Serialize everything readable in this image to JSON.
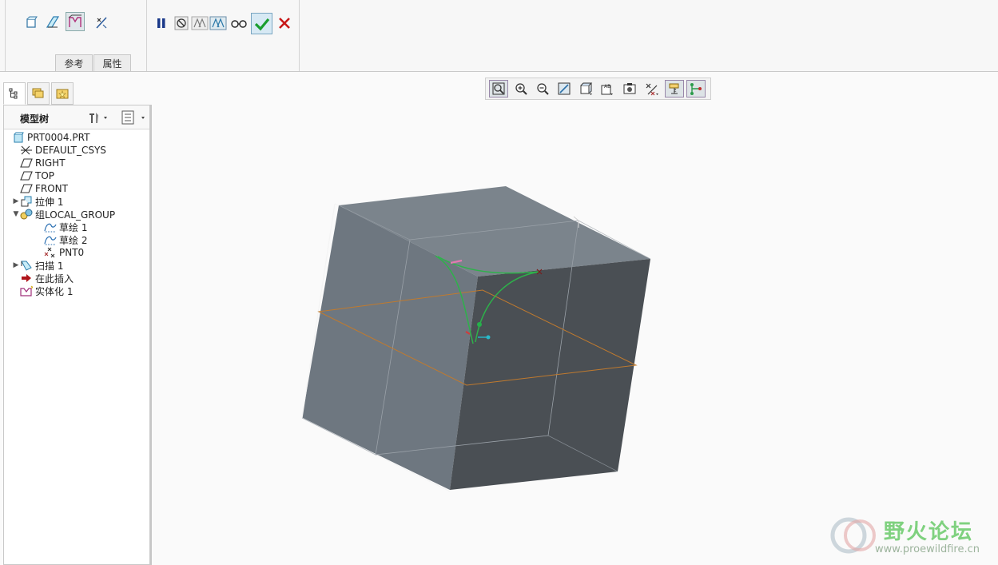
{
  "dashboard": {
    "tabs": {
      "references": "参考",
      "properties": "属性"
    },
    "left_tools": [
      "solid-icon",
      "surface-icon",
      "thicken-sketch-icon",
      "remove-material-icon"
    ],
    "mid_tools": [
      "pause-icon",
      "no-preview-icon",
      "attach-preview-icon",
      "verify-preview-icon",
      "glasses-preview-icon",
      "confirm-check-icon",
      "cancel-x-icon"
    ]
  },
  "panel": {
    "tabs": [
      "model-tree-tab",
      "folder-browser-tab",
      "favorites-tab"
    ],
    "title": "模型树"
  },
  "tree": {
    "items": [
      {
        "label": "PRT0004.PRT",
        "icon": "part-icon",
        "expander": ""
      },
      {
        "label": "DEFAULT_CSYS",
        "icon": "csys-icon",
        "expander": ""
      },
      {
        "label": "RIGHT",
        "icon": "datum-plane-icon",
        "expander": ""
      },
      {
        "label": "TOP",
        "icon": "datum-plane-icon",
        "expander": ""
      },
      {
        "label": "FRONT",
        "icon": "datum-plane-icon",
        "expander": ""
      },
      {
        "label": "拉伸 1",
        "icon": "extrude-icon",
        "expander": "▶"
      },
      {
        "label": "组LOCAL_GROUP",
        "icon": "group-icon",
        "expander": "▼"
      },
      {
        "label": "草绘 1",
        "icon": "sketch-icon",
        "expander": ""
      },
      {
        "label": "草绘 2",
        "icon": "sketch-icon",
        "expander": ""
      },
      {
        "label": "PNT0",
        "icon": "datum-point-icon",
        "expander": ""
      },
      {
        "label": "扫描 1",
        "icon": "sweep-icon",
        "expander": "▶"
      },
      {
        "label": "在此插入",
        "icon": "insert-here-arrow-icon",
        "expander": ""
      },
      {
        "label": "实体化 1",
        "icon": "solidify-icon",
        "expander": ""
      }
    ]
  },
  "view_toolbar": [
    "refit-icon",
    "zoom-in-icon",
    "zoom-out-icon",
    "repaint-icon",
    "display-style-icon",
    "saved-orientations-icon",
    "view-manager-icon",
    "datum-display-icon",
    "spin-center-icon",
    "annotation-display-icon"
  ],
  "watermark": {
    "text": "野火论坛",
    "url": "www.proewildfire.cn"
  },
  "colors": {
    "cube_top": "#7b848c",
    "cube_left": "#6e7780",
    "cube_right": "#4a4f54",
    "curve": "#2db24a",
    "plane": "#c07a2e"
  }
}
